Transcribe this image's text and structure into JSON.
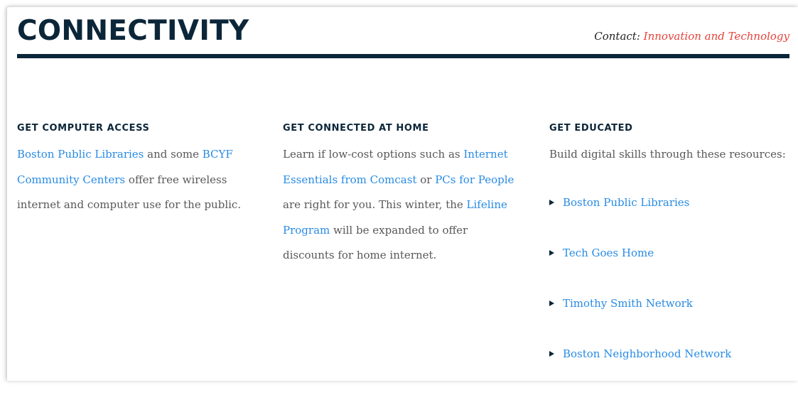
{
  "header": {
    "title": "CONNECTIVITY",
    "contact_label": "Contact:",
    "contact_link": "Innovation and Technology"
  },
  "columns": [
    {
      "heading": "GET COMPUTER ACCESS",
      "link1": "Boston Public Libraries",
      "text1": " and some ",
      "link2": "BCYF Community Centers",
      "text2": " offer free wireless internet and computer use for the public."
    },
    {
      "heading": "GET CONNECTED AT HOME",
      "text1": "Learn if low-cost options such as ",
      "link1": "Internet Essentials from Comcast",
      "text2": " or ",
      "link2": "PCs for People",
      "text3": " are right for you. This winter, the ",
      "link3": "Lifeline Program",
      "text4": " will be expanded to offer discounts for home internet."
    },
    {
      "heading": "GET EDUCATED",
      "intro": "Build digital skills through these resources:",
      "resources": [
        "Boston Public Libraries",
        "Tech Goes Home",
        "Timothy Smith Network",
        "Boston Neighborhood Network"
      ]
    }
  ],
  "icons": {
    "bullet": "triangle-right-icon"
  },
  "colors": {
    "navy": "#0c2639",
    "link": "#288be4",
    "contact_link": "#e6423a",
    "body_text": "#58585b"
  }
}
